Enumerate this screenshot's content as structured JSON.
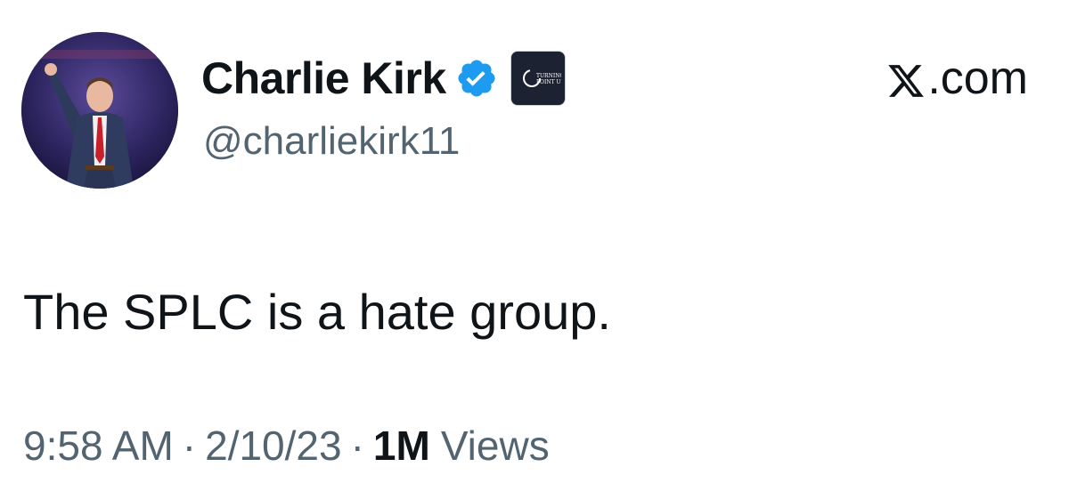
{
  "author": {
    "display_name": "Charlie Kirk",
    "handle": "@charliekirk11",
    "verified": true,
    "verified_color": "#1d9bf0",
    "affiliate_badge_text": "TURNING POINT USA"
  },
  "site": {
    "label": ".com",
    "icon": "x-logo-icon"
  },
  "tweet": {
    "text": "The SPLC is a hate group."
  },
  "meta": {
    "time": "9:58 AM",
    "separator": "·",
    "date": "2/10/23",
    "views_count": "1M",
    "views_label": "Views"
  },
  "colors": {
    "text_primary": "#0f1419",
    "text_secondary": "#536471",
    "background": "#ffffff"
  }
}
